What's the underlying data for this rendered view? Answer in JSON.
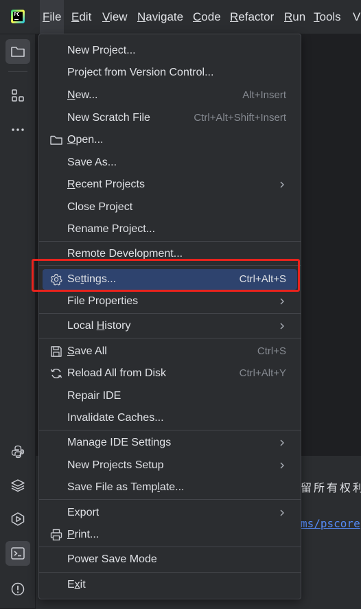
{
  "menubar": {
    "app_logo_text": "PC",
    "items": [
      {
        "label": "File",
        "mn": "F",
        "rest": "ile"
      },
      {
        "label": "Edit",
        "mn": "E",
        "rest": "dit"
      },
      {
        "label": "View",
        "mn": "V",
        "rest": "iew"
      },
      {
        "label": "Navigate",
        "mn": "N",
        "rest": "avigate"
      },
      {
        "label": "Code",
        "mn": "C",
        "rest": "ode"
      },
      {
        "label": "Refactor",
        "mn": "R",
        "rest": "efactor"
      },
      {
        "label": "Run",
        "mn": "R",
        "rest": "un"
      },
      {
        "label": "Tools",
        "mn": "T",
        "rest": "ools"
      },
      {
        "label": "VC",
        "mn": "",
        "rest": "VC"
      }
    ]
  },
  "toolstrip": {
    "icons": [
      "folder-icon",
      "structure-icon",
      "more-icon",
      "python-console-icon",
      "layers-icon",
      "services-icon",
      "terminal-icon",
      "problems-icon"
    ]
  },
  "terminal": {
    "line1": "留所有权利",
    "line2": "ms/pscore"
  },
  "file_menu": {
    "items": [
      {
        "id": "new-project",
        "label": "New Project..."
      },
      {
        "id": "project-from-vcs",
        "label": "Project from Version Control..."
      },
      {
        "id": "new",
        "pre": "",
        "mn": "N",
        "post": "ew...",
        "shortcut": "Alt+Insert"
      },
      {
        "id": "new-scratch-file",
        "label": "New Scratch File",
        "shortcut": "Ctrl+Alt+Shift+Insert"
      },
      {
        "id": "open",
        "pre": "",
        "mn": "O",
        "post": "pen...",
        "icon": "folder-icon"
      },
      {
        "id": "save-as",
        "label": "Save As..."
      },
      {
        "id": "recent-projects",
        "pre": "",
        "mn": "R",
        "post": "ecent Projects",
        "submenu": true
      },
      {
        "id": "close-project",
        "label": "Close Project"
      },
      {
        "id": "rename-project",
        "label": "Rename Project..."
      },
      {
        "id": "remote-development",
        "label": "Remote Development..."
      },
      {
        "id": "settings",
        "pre": "Se",
        "mn": "t",
        "post": "tings...",
        "shortcut": "Ctrl+Alt+S",
        "icon": "gear-icon",
        "highlighted": true
      },
      {
        "id": "file-properties",
        "label": "File Properties",
        "submenu": true
      },
      {
        "id": "local-history",
        "pre": "Local ",
        "mn": "H",
        "post": "istory",
        "submenu": true
      },
      {
        "id": "save-all",
        "pre": "",
        "mn": "S",
        "post": "ave All",
        "shortcut": "Ctrl+S",
        "icon": "save-icon"
      },
      {
        "id": "reload-all",
        "label": "Reload All from Disk",
        "shortcut": "Ctrl+Alt+Y",
        "icon": "reload-icon"
      },
      {
        "id": "repair-ide",
        "label": "Repair IDE"
      },
      {
        "id": "invalidate-caches",
        "label": "Invalidate Caches..."
      },
      {
        "id": "manage-ide-settings",
        "label": "Manage IDE Settings",
        "submenu": true
      },
      {
        "id": "new-projects-setup",
        "label": "New Projects Setup",
        "submenu": true
      },
      {
        "id": "save-file-as-template",
        "pre": "Save File as Temp",
        "mn": "l",
        "post": "ate..."
      },
      {
        "id": "export",
        "label": "Export",
        "submenu": true
      },
      {
        "id": "print",
        "pre": "",
        "mn": "P",
        "post": "rint...",
        "icon": "print-icon"
      },
      {
        "id": "power-save-mode",
        "label": "Power Save Mode"
      },
      {
        "id": "exit",
        "pre": "E",
        "mn": "x",
        "post": "it"
      }
    ]
  },
  "colors": {
    "menu_bg": "#2b2d30",
    "highlight": "#2e436e",
    "annotation_box": "#e8231d",
    "text": "#dfe1e5",
    "shortcut": "#868a91"
  }
}
